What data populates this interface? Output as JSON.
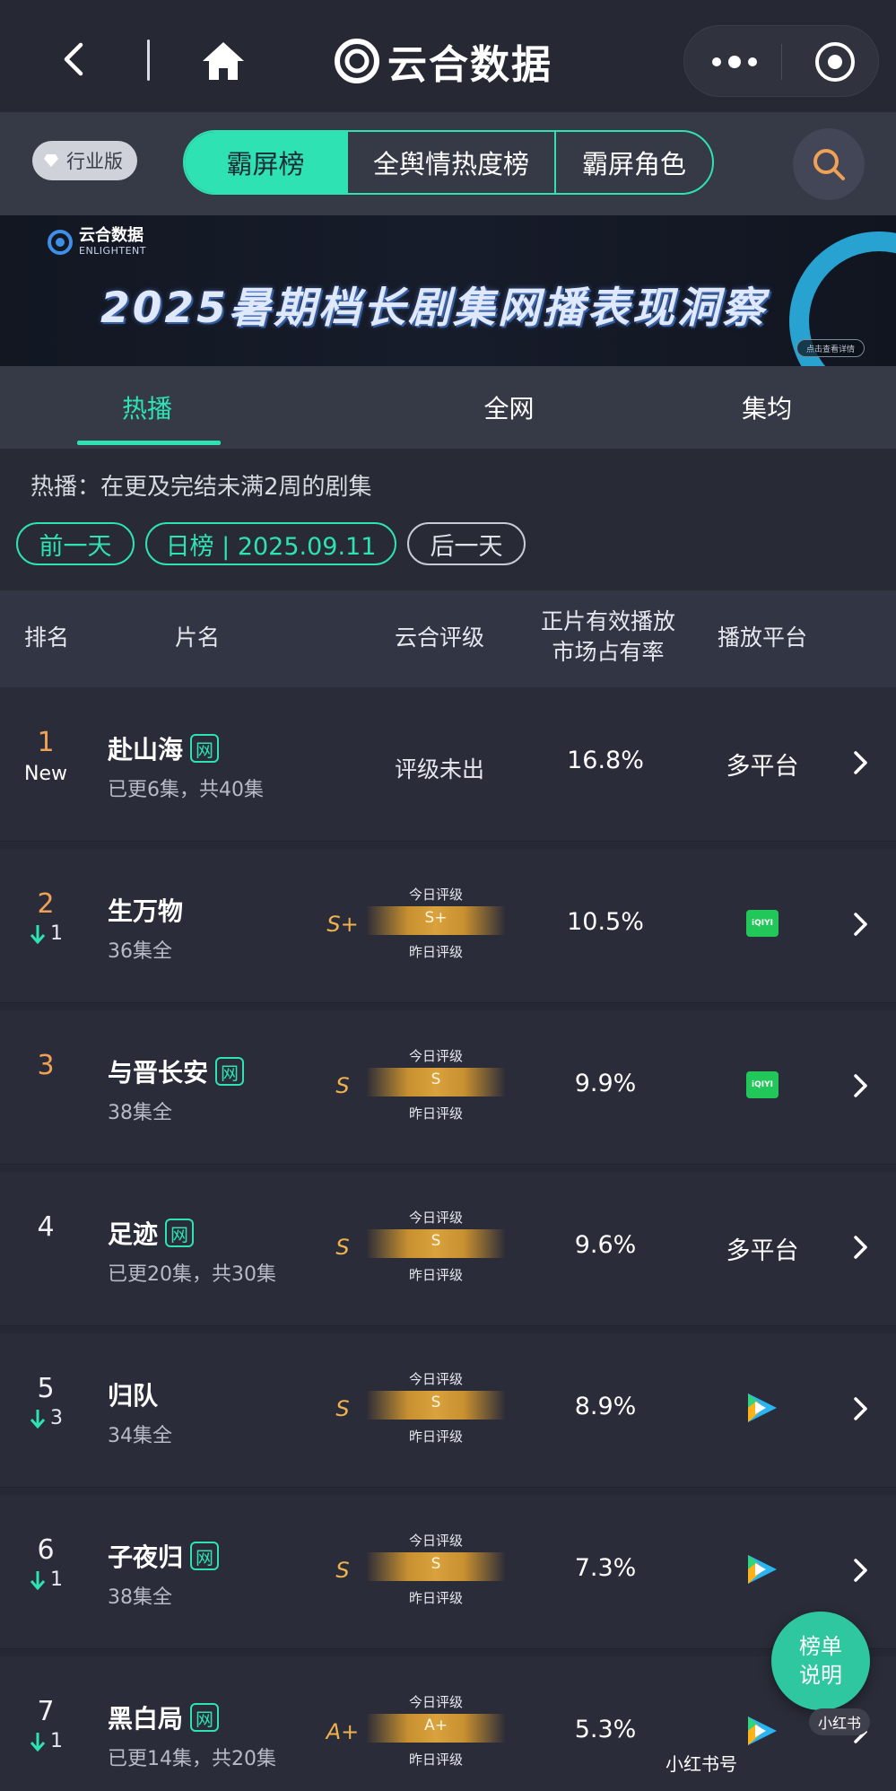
{
  "topbar": {
    "brand_title": "云合数据",
    "icons": [
      "back-icon",
      "home-icon",
      "more-icon",
      "target-icon"
    ]
  },
  "nav": {
    "edition_badge": "行业版",
    "segments": [
      "霸屏榜",
      "全舆情热度榜",
      "霸屏角色"
    ],
    "active_segment": 0
  },
  "banner": {
    "logo_cn": "云合数据",
    "logo_en": "ENLIGHTENT",
    "title": "2025暑期档长剧集网播表现洞察",
    "pill": "点击查看详情"
  },
  "tabs": [
    "热播",
    "全网",
    "集均"
  ],
  "active_tab": 0,
  "filter": {
    "description": "热播：在更及完结未满2周的剧集",
    "prev_label": "前一天",
    "date_label": "日榜 | 2025.09.11",
    "next_label": "后一天"
  },
  "table": {
    "headers": {
      "rank": "排名",
      "title": "片名",
      "rating": "云合评级",
      "share_line1": "正片有效播放",
      "share_line2": "市场占有率",
      "platform": "播放平台"
    },
    "grade_today_label": "今日评级",
    "grade_yday_label": "昨日评级",
    "rows": [
      {
        "rank": "1",
        "change": "",
        "is_new": "New",
        "title": "赴山海",
        "net": "网",
        "episodes": "已更6集，共40集",
        "rating_text": "评级未出",
        "grade": "",
        "share": "16.8%",
        "platform": "多平台",
        "platform_icon": ""
      },
      {
        "rank": "2",
        "change": "1",
        "is_new": "",
        "title": "生万物",
        "net": "",
        "episodes": "36集全",
        "rating_text": "",
        "grade": "S+",
        "share": "10.5%",
        "platform": "",
        "platform_icon": "iqiyi-icon"
      },
      {
        "rank": "3",
        "change": "",
        "is_new": "",
        "title": "与晋长安",
        "net": "网",
        "episodes": "38集全",
        "rating_text": "",
        "grade": "S",
        "share": "9.9%",
        "platform": "",
        "platform_icon": "iqiyi-icon"
      },
      {
        "rank": "4",
        "change": "",
        "is_new": "",
        "title": "足迹",
        "net": "网",
        "episodes": "已更20集，共30集",
        "rating_text": "",
        "grade": "S",
        "share": "9.6%",
        "platform": "多平台",
        "platform_icon": ""
      },
      {
        "rank": "5",
        "change": "3",
        "is_new": "",
        "title": "归队",
        "net": "",
        "episodes": "34集全",
        "rating_text": "",
        "grade": "S",
        "share": "8.9%",
        "platform": "",
        "platform_icon": "tencent-video-icon"
      },
      {
        "rank": "6",
        "change": "1",
        "is_new": "",
        "title": "子夜归",
        "net": "网",
        "episodes": "38集全",
        "rating_text": "",
        "grade": "S",
        "share": "7.3%",
        "platform": "",
        "platform_icon": "tencent-video-icon"
      },
      {
        "rank": "7",
        "change": "1",
        "is_new": "",
        "title": "黑白局",
        "net": "网",
        "episodes": "已更14集，共20集",
        "rating_text": "",
        "grade": "A+",
        "share": "5.3%",
        "platform": "",
        "platform_icon": "tencent-video-icon"
      }
    ]
  },
  "iqiyi_label": "iQIYI",
  "float_button": {
    "line1": "榜单",
    "line2": "说明"
  },
  "watermark": {
    "badge": "小红书",
    "text": "小红书号"
  },
  "colors": {
    "accent": "#2ee2b4",
    "top_rank": "#f0a155",
    "grade": "#f0b24f",
    "iqiyi": "#22c75a"
  }
}
